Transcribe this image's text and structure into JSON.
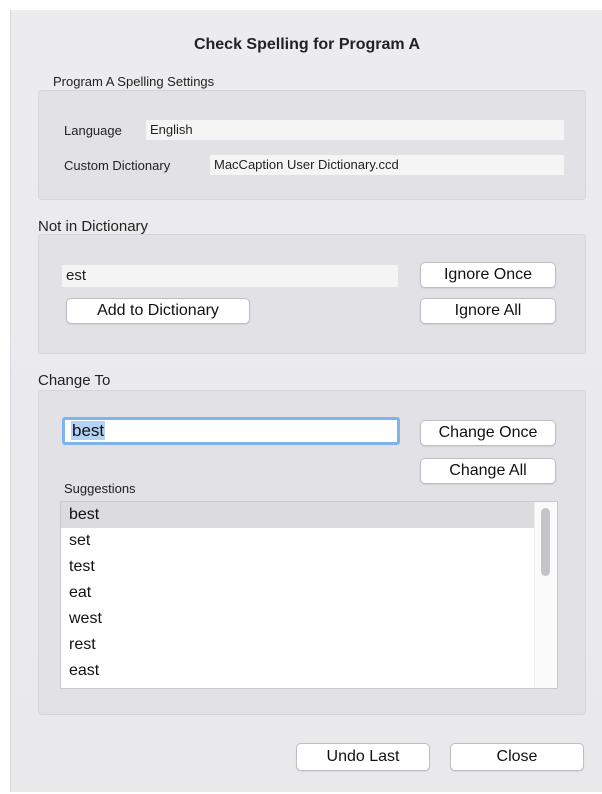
{
  "dialog": {
    "title": "Check Spelling for Program A"
  },
  "settings": {
    "section_label": "Program A Spelling Settings",
    "language_label": "Language",
    "language_value": "English",
    "dictionary_label": "Custom Dictionary",
    "dictionary_value": "MacCaption User Dictionary.ccd"
  },
  "not_in_dictionary": {
    "section_label": "Not in Dictionary",
    "word": "est",
    "ignore_once_label": "Ignore Once",
    "ignore_all_label": "Ignore All",
    "add_label": "Add to Dictionary"
  },
  "change_to": {
    "section_label": "Change To",
    "value": "best",
    "change_once_label": "Change Once",
    "change_all_label": "Change All",
    "suggestions_label": "Suggestions",
    "suggestions": [
      "best",
      "set",
      "test",
      "eat",
      "west",
      "rest",
      "east"
    ],
    "selected_index": 0
  },
  "footer": {
    "undo_label": "Undo Last",
    "close_label": "Close"
  },
  "colors": {
    "focus_ring": "#7db4ee",
    "text_selection": "#b3d2f5",
    "list_selection": "#dcdcdf"
  }
}
